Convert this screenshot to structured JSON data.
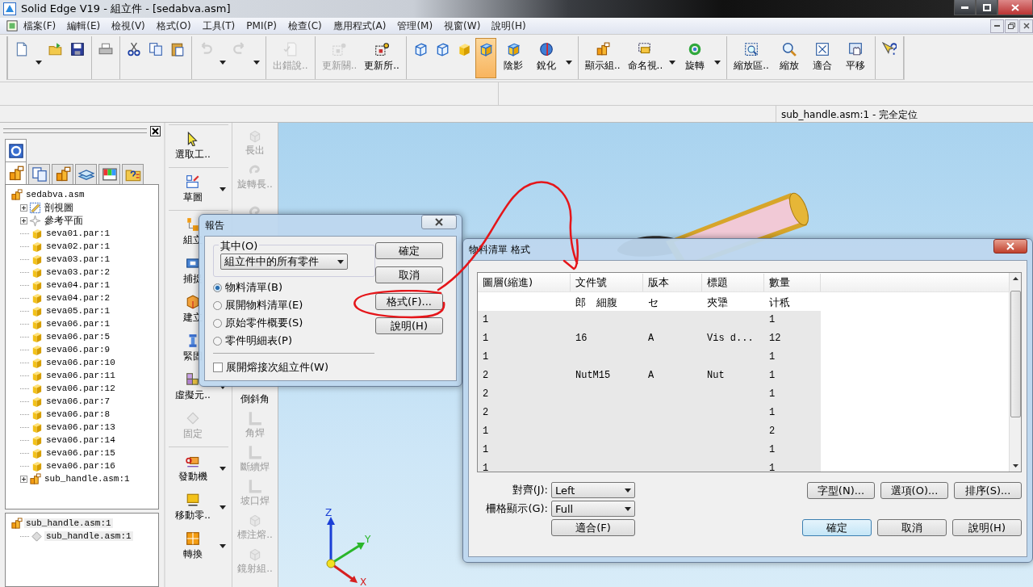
{
  "window": {
    "title": "Solid Edge V19 - 組立件 - [sedabva.asm]"
  },
  "menu": [
    "檔案(F)",
    "編輯(E)",
    "檢視(V)",
    "格式(O)",
    "工具(T)",
    "PMI(P)",
    "檢查(C)",
    "應用程式(A)",
    "管理(M)",
    "視窗(W)",
    "說明(H)"
  ],
  "toolbar": [
    {
      "buttons": [
        {
          "dropdown": true,
          "disabled": false
        },
        {
          "dropdown": false,
          "disabled": false
        },
        {
          "dropdown": false,
          "disabled": false
        }
      ]
    },
    {
      "buttons": [
        {
          "dropdown": false,
          "disabled": false
        }
      ]
    },
    {
      "buttons": [
        {
          "dropdown": false,
          "disabled": false
        },
        {
          "dropdown": false,
          "disabled": false
        },
        {
          "dropdown": false,
          "disabled": false
        }
      ]
    },
    {
      "buttons": [
        {
          "dropdown": true,
          "disabled": true
        },
        {
          "dropdown": true,
          "disabled": true
        }
      ]
    },
    {
      "buttons": [
        {
          "label": "出錯說..",
          "dropdown": false,
          "disabled": true
        }
      ]
    },
    {
      "buttons": [
        {
          "label": "更新關..",
          "dropdown": false,
          "disabled": true
        },
        {
          "label": "更新所..",
          "dropdown": false,
          "disabled": false
        }
      ]
    },
    {
      "buttons": [
        {
          "dropdown": false,
          "disabled": false,
          "selected": false
        },
        {
          "dropdown": false,
          "disabled": false,
          "selected": false
        },
        {
          "dropdown": false,
          "disabled": false,
          "selected": false
        },
        {
          "dropdown": false,
          "disabled": false,
          "selected": true
        },
        {
          "label": "陰影",
          "dropdown": false,
          "disabled": false,
          "selected": false
        },
        {
          "label": "銳化",
          "dropdown": true,
          "disabled": false,
          "selected": false
        }
      ]
    },
    {
      "buttons": [
        {
          "label": "顯示組..",
          "dropdown": false,
          "disabled": false
        },
        {
          "label": "命名視..",
          "dropdown": true,
          "disabled": false
        },
        {
          "label": "旋轉",
          "dropdown": true,
          "disabled": false
        }
      ]
    },
    {
      "buttons": [
        {
          "label": "縮放區..",
          "dropdown": false,
          "disabled": false
        },
        {
          "label": "縮放",
          "dropdown": false,
          "disabled": false
        },
        {
          "label": "適合",
          "dropdown": false,
          "disabled": false
        },
        {
          "label": "平移",
          "dropdown": false,
          "disabled": false
        }
      ]
    },
    {
      "buttons": [
        {
          "dropdown": false,
          "disabled": false
        }
      ]
    }
  ],
  "status": "sub_handle.asm:1 - 完全定位",
  "pathfinder": {
    "tab_rows": [
      [
        {
          "selected": true
        }
      ],
      [
        {
          "selected": true
        },
        {
          "selected": false
        },
        {
          "selected": false
        },
        {
          "selected": false
        },
        {
          "selected": false
        },
        {
          "selected": false
        }
      ]
    ],
    "tree": [
      {
        "label": "sedabva.asm",
        "kind": "assembly",
        "children": [
          {
            "label": "剖視圖",
            "kind": "section",
            "expanded": false
          },
          {
            "label": "參考平面",
            "kind": "planes",
            "expanded": false
          },
          {
            "label": "seva01.par:1",
            "kind": "part"
          },
          {
            "label": "seva02.par:1",
            "kind": "part"
          },
          {
            "label": "seva03.par:1",
            "kind": "part"
          },
          {
            "label": "seva03.par:2",
            "kind": "part"
          },
          {
            "label": "seva04.par:1",
            "kind": "part"
          },
          {
            "label": "seva04.par:2",
            "kind": "part"
          },
          {
            "label": "seva05.par:1",
            "kind": "part"
          },
          {
            "label": "seva06.par:1",
            "kind": "part"
          },
          {
            "label": "seva06.par:5",
            "kind": "part"
          },
          {
            "label": "seva06.par:9",
            "kind": "part"
          },
          {
            "label": "seva06.par:10",
            "kind": "part"
          },
          {
            "label": "seva06.par:11",
            "kind": "part"
          },
          {
            "label": "seva06.par:12",
            "kind": "part"
          },
          {
            "label": "seva06.par:7",
            "kind": "part"
          },
          {
            "label": "seva06.par:8",
            "kind": "part"
          },
          {
            "label": "seva06.par:13",
            "kind": "part"
          },
          {
            "label": "seva06.par:14",
            "kind": "part"
          },
          {
            "label": "seva06.par:15",
            "kind": "part"
          },
          {
            "label": "seva06.par:16",
            "kind": "part"
          },
          {
            "label": "sub_handle.asm:1",
            "kind": "assembly",
            "expanded": false
          }
        ]
      }
    ],
    "lower_tree": [
      {
        "label": "sub_handle.asm:1",
        "kind": "assembly",
        "children": [
          {
            "label": "sub_handle.asm:1",
            "kind": "component"
          }
        ]
      }
    ]
  },
  "commands": [
    [
      {
        "label": "選取工..",
        "dropdown": false,
        "disabled": false
      }
    ],
    [
      {
        "label": "草圖",
        "dropdown": true,
        "disabled": false
      }
    ],
    [
      {
        "label": "組立",
        "dropdown": false,
        "disabled": false
      },
      {
        "label": "捕捉",
        "dropdown": false,
        "disabled": false
      },
      {
        "label": "建立",
        "dropdown": false,
        "disabled": false
      },
      {
        "label": "緊固",
        "dropdown": false,
        "disabled": false
      },
      {
        "label": "虛擬元..",
        "dropdown": true,
        "disabled": false
      },
      {
        "label": "固定",
        "dropdown": false,
        "disabled": true
      }
    ],
    [
      {
        "label": "發動機",
        "dropdown": true,
        "disabled": false
      },
      {
        "label": "移動零..",
        "dropdown": true,
        "disabled": false
      },
      {
        "label": "轉換",
        "dropdown": true,
        "disabled": false
      }
    ]
  ],
  "features": [
    [
      {
        "label": "長出",
        "disabled": true
      },
      {
        "label": "旋轉長..",
        "disabled": true
      },
      {
        "disabled": true
      }
    ],
    [
      {
        "label": "倒斜角",
        "disabled": false
      },
      {
        "label": "角焊",
        "disabled": true
      },
      {
        "label": "斷續焊",
        "disabled": true
      },
      {
        "label": "坡口焊",
        "disabled": true
      },
      {
        "label": "標注熔..",
        "disabled": true
      },
      {
        "label": "鏡射組..",
        "disabled": true
      }
    ]
  ],
  "triad": {
    "z": "Z",
    "y": "Y",
    "x": "X"
  },
  "report_dialog": {
    "title": "報告",
    "group_label": "其中(O)",
    "scope": "組立件中的所有零件",
    "options": [
      {
        "label": "物料清單(B)",
        "selected": true
      },
      {
        "label": "展開物料清單(E)",
        "selected": false
      },
      {
        "label": "原始零件概要(S)",
        "selected": false
      },
      {
        "label": "零件明細表(P)",
        "selected": false
      }
    ],
    "expand_weldments": {
      "label": "展開熔接次組立件(W)",
      "checked": false
    },
    "buttons": [
      "確定",
      "取消",
      "格式(F)...",
      "說明(H)"
    ]
  },
  "bom_dialog": {
    "title": "物料清單 格式",
    "columns": [
      "圖層(縮進)",
      "文件號",
      "版本",
      "標題",
      "數量"
    ],
    "subheader": {
      "document_number": "郎　細腹",
      "revision": "セ",
      "title": "夾犟",
      "quantity": "计秖"
    },
    "rows": [
      {
        "level": "1",
        "quantity": "1"
      },
      {
        "level": "1",
        "document_number": "16",
        "revision": "A",
        "title": "Vis d...",
        "quantity": "12"
      },
      {
        "level": "1",
        "quantity": "1"
      },
      {
        "level": "2",
        "document_number": "NutM15",
        "revision": "A",
        "title": "Nut",
        "quantity": "1"
      },
      {
        "level": "2",
        "quantity": "1"
      },
      {
        "level": "2",
        "quantity": "1"
      },
      {
        "level": "1",
        "quantity": "2"
      },
      {
        "level": "1",
        "quantity": "1"
      },
      {
        "level": "1",
        "quantity": "1"
      }
    ],
    "align": {
      "label": "對齊(J):",
      "value": "Left"
    },
    "grid": {
      "label": "柵格顯示(G):",
      "value": "Full"
    },
    "fit_button": "適合(F)",
    "side_buttons": [
      "字型(N)...",
      "選項(O)...",
      "排序(S)..."
    ],
    "buttons": [
      {
        "label": "確定",
        "default": true
      },
      {
        "label": "取消",
        "default": false
      },
      {
        "label": "說明(H)",
        "default": false
      }
    ]
  }
}
